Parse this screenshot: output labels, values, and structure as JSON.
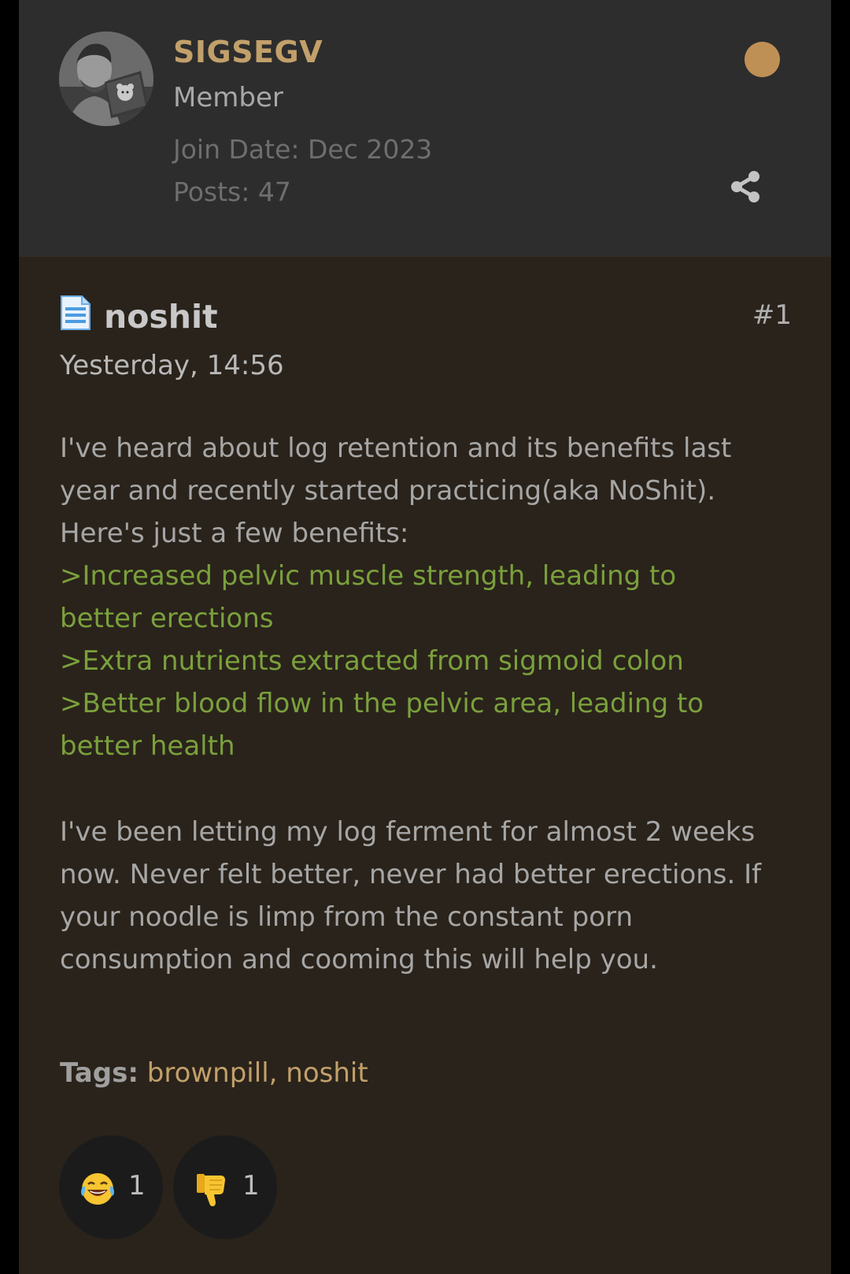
{
  "author": {
    "username": "SIGSEGV",
    "role": "Member",
    "join_date": "Join Date: Dec 2023",
    "posts": "Posts: 47",
    "status_color": "#bf9055"
  },
  "post": {
    "title": "noshit",
    "number": "#1",
    "timestamp": "Yesterday, 14:56",
    "intro_lines": [
      "I've heard about log retention and its benefits last",
      "year and recently started practicing(aka NoShit).",
      "Here's just a few benefits:"
    ],
    "greentext_lines": [
      ">Increased pelvic muscle strength, leading to",
      "better erections",
      ">Extra nutrients extracted from sigmoid colon",
      ">Better blood flow in the pelvic area, leading to",
      "better health"
    ],
    "closing_lines": [
      "I've been letting my log ferment for almost 2 weeks",
      "now. Never felt better, never had better erections. If",
      "your noodle is limp from the constant porn",
      "consumption and cooming this will help you."
    ],
    "tags_label": "Tags:",
    "tags": [
      "brownpill",
      "noshit"
    ],
    "tag_separator": ", "
  },
  "reactions": [
    {
      "icon": "laughing-tears-emoji-icon",
      "count": "1"
    },
    {
      "icon": "thumbs-down-emoji-icon",
      "count": "1"
    }
  ],
  "colors": {
    "accent": "#c2a06a",
    "greentext": "#7aa03c",
    "header_bg": "#2d2d2d",
    "post_bg": "#2a231b"
  }
}
